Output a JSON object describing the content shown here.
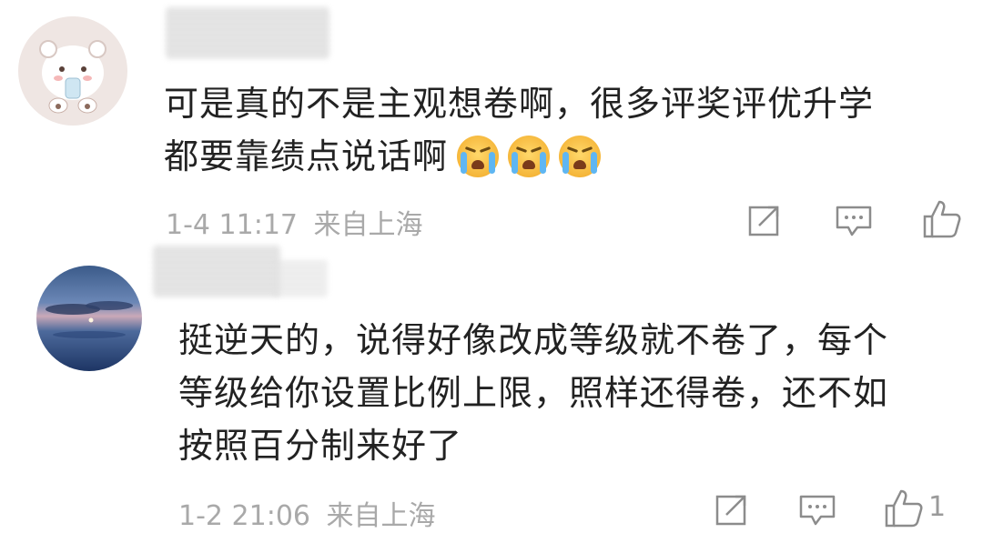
{
  "comments": [
    {
      "text_line1": "可是真的不是主观想卷啊，很多评奖评优升学",
      "text_line2": "都要靠绩点说话啊",
      "emojis": [
        "crying-face-emoji",
        "crying-face-emoji",
        "crying-face-emoji"
      ],
      "date": "1-4 11:17",
      "location": "来自上海",
      "like_count": ""
    },
    {
      "text_line1": "挺逆天的，说得好像改成等级就不卷了，每个",
      "text_line2": "等级给你设置比例上限，照样还得卷，还不如",
      "text_line3": "按照百分制来好了",
      "date": "1-2 21:06",
      "location": "来自上海",
      "like_count": "1"
    }
  ],
  "colors": {
    "meta": "#a9a9a9",
    "icon": "#8c8c8c",
    "text": "#222222"
  },
  "icons": [
    "edit-share-icon",
    "comment-icon",
    "like-icon"
  ]
}
